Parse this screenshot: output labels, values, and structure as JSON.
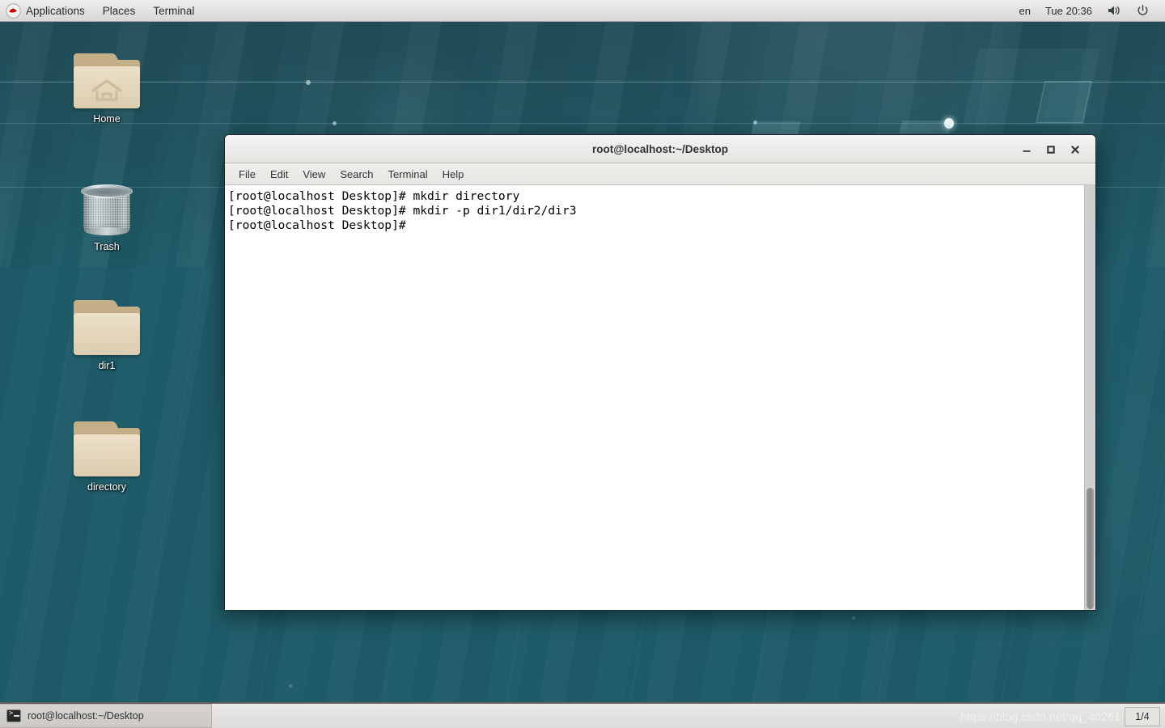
{
  "top_panel": {
    "logo_icon": "redhat-logo-icon",
    "menus": [
      {
        "label": "Applications"
      },
      {
        "label": "Places"
      },
      {
        "label": "Terminal"
      }
    ],
    "tray": {
      "input_source": "en",
      "clock": "Tue 20:36",
      "volume_icon": "speaker-icon",
      "power_icon": "power-icon"
    }
  },
  "desktop": {
    "icons": [
      {
        "name": "Home",
        "type": "folder-home"
      },
      {
        "name": "Trash",
        "type": "trash"
      },
      {
        "name": "dir1",
        "type": "folder"
      },
      {
        "name": "directory",
        "type": "folder"
      }
    ]
  },
  "terminal": {
    "title": "root@localhost:~/Desktop",
    "window_buttons": {
      "minimize": "–",
      "maximize": "□",
      "close": "✕"
    },
    "menubar": [
      {
        "label": "File"
      },
      {
        "label": "Edit"
      },
      {
        "label": "View"
      },
      {
        "label": "Search"
      },
      {
        "label": "Terminal"
      },
      {
        "label": "Help"
      }
    ],
    "content": "[root@localhost Desktop]# mkdir directory\n[root@localhost Desktop]# mkdir -p dir1/dir2/dir3\n[root@localhost Desktop]# "
  },
  "bottom_panel": {
    "task": {
      "label": "root@localhost:~/Desktop",
      "icon": "terminal-icon"
    },
    "watermark": "https://blog.csdn.net/qq_40261",
    "workspace": "1/4"
  },
  "colors": {
    "desktop_teal": "#1e5b68",
    "desktop_teal_dark": "#234a56",
    "panel_gray": "#e4e2e0",
    "terminal_bg": "#ffffff",
    "terminal_fg": "#000000"
  }
}
